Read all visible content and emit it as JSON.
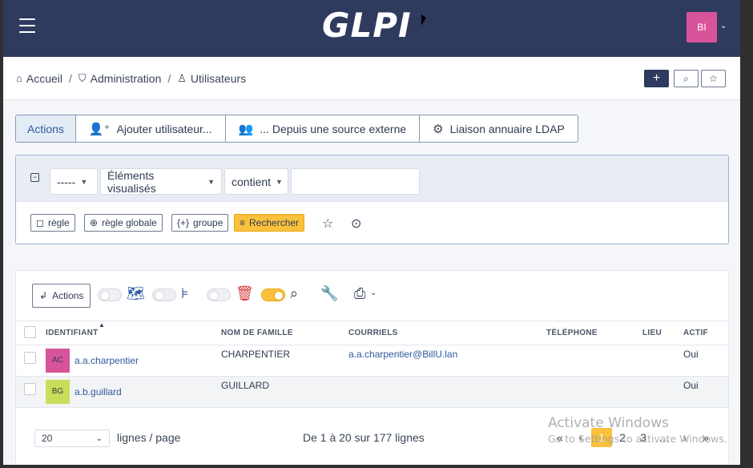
{
  "header": {
    "logo": "GLPI",
    "avatar_initials": "BI",
    "avatar_color": "#d8549a"
  },
  "breadcrumb": {
    "items": [
      "Accueil",
      "Administration",
      "Utilisateurs"
    ]
  },
  "header_buttons": {
    "add_icon": "plus-icon",
    "search_icon": "search-icon",
    "star_icon": "star-icon"
  },
  "actions_bar": {
    "actions_label": "Actions",
    "add_user_label": "Ajouter utilisateur...",
    "external_source_label": "... Depuis une source externe",
    "ldap_label": "Liaison annuaire LDAP"
  },
  "search": {
    "field_select": "-----",
    "criteria_select": "Éléments visualisés",
    "operator_select": "contient",
    "value_input": "",
    "rule_button": "règle",
    "global_rule_button": "règle globale",
    "group_button": "groupe",
    "search_button": "Rechercher"
  },
  "results": {
    "actions_button": "Actions",
    "columns": [
      "IDENTIFIANT",
      "NOM DE FAMILLE",
      "COURRIELS",
      "TÉLÉPHONE",
      "LIEU",
      "ACTIF"
    ],
    "rows": [
      {
        "initials": "AC",
        "avatar_color": "#d8549a",
        "login": "a.a.charpentier",
        "lastname": "CHARPENTIER",
        "email": "a.a.charpentier@BillU.lan",
        "phone": "",
        "location": "",
        "active": "Oui"
      },
      {
        "initials": "BG",
        "avatar_color": "#c9de58",
        "login": "a.b.guillard",
        "lastname": "GUILLARD",
        "email": "",
        "phone": "",
        "location": "",
        "active": "Oui"
      }
    ]
  },
  "footer": {
    "per_page_value": "20",
    "per_page_label": "lignes / page",
    "range_text": "De 1 à 20 sur 177 lignes",
    "pages": [
      "1",
      "2",
      "3"
    ],
    "current_page": "1"
  },
  "watermark": {
    "line1": "Activate Windows",
    "line2": "Go to Settings to activate Windows."
  }
}
